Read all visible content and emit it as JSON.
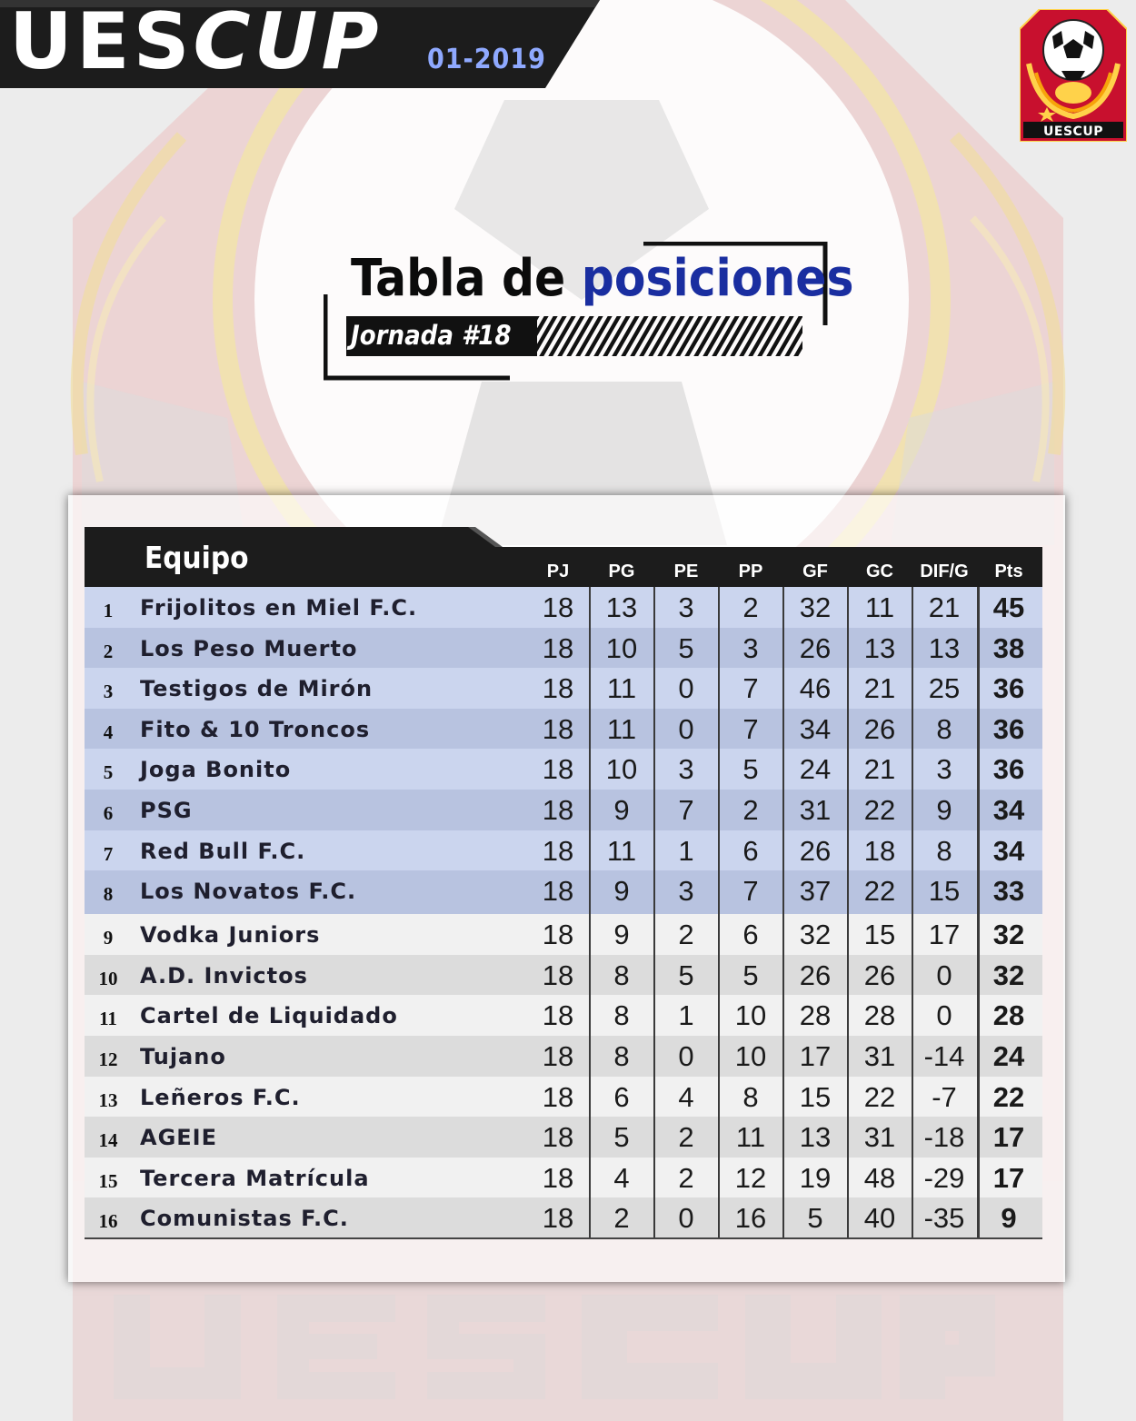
{
  "brand": {
    "title_a": "UES",
    "title_b": "CUP",
    "season": "01-2019",
    "logo_text": "UESCUP"
  },
  "heading": {
    "title_a": "Tabla de",
    "title_b": "posiciones",
    "subtitle": "Jornada #18"
  },
  "colors": {
    "brand_dark": "#1a1a1a",
    "accent_blue": "#1a2ea0",
    "season_blue": "#8fa9ff",
    "top8_row": "#cbd5ee",
    "logo_red": "#c8102e"
  },
  "table": {
    "team_header": "Equipo",
    "columns": [
      "PJ",
      "PG",
      "PE",
      "PP",
      "GF",
      "GC",
      "DIF/G",
      "Pts"
    ],
    "rows": [
      {
        "rank": "1",
        "team": "Frijolitos en Miel F.C.",
        "PJ": "18",
        "PG": "13",
        "PE": "3",
        "PP": "2",
        "GF": "32",
        "GC": "11",
        "DIF": "21",
        "Pts": "45"
      },
      {
        "rank": "2",
        "team": "Los Peso Muerto",
        "PJ": "18",
        "PG": "10",
        "PE": "5",
        "PP": "3",
        "GF": "26",
        "GC": "13",
        "DIF": "13",
        "Pts": "38"
      },
      {
        "rank": "3",
        "team": "Testigos de Mirón",
        "PJ": "18",
        "PG": "11",
        "PE": "0",
        "PP": "7",
        "GF": "46",
        "GC": "21",
        "DIF": "25",
        "Pts": "36"
      },
      {
        "rank": "4",
        "team": "Fito & 10 Troncos",
        "PJ": "18",
        "PG": "11",
        "PE": "0",
        "PP": "7",
        "GF": "34",
        "GC": "26",
        "DIF": "8",
        "Pts": "36"
      },
      {
        "rank": "5",
        "team": "Joga Bonito",
        "PJ": "18",
        "PG": "10",
        "PE": "3",
        "PP": "5",
        "GF": "24",
        "GC": "21",
        "DIF": "3",
        "Pts": "36"
      },
      {
        "rank": "6",
        "team": "PSG",
        "PJ": "18",
        "PG": "9",
        "PE": "7",
        "PP": "2",
        "GF": "31",
        "GC": "22",
        "DIF": "9",
        "Pts": "34"
      },
      {
        "rank": "7",
        "team": "Red Bull F.C.",
        "PJ": "18",
        "PG": "11",
        "PE": "1",
        "PP": "6",
        "GF": "26",
        "GC": "18",
        "DIF": "8",
        "Pts": "34"
      },
      {
        "rank": "8",
        "team": "Los Novatos F.C.",
        "PJ": "18",
        "PG": "9",
        "PE": "3",
        "PP": "7",
        "GF": "37",
        "GC": "22",
        "DIF": "15",
        "Pts": "33"
      },
      {
        "rank": "9",
        "team": "Vodka Juniors",
        "PJ": "18",
        "PG": "9",
        "PE": "2",
        "PP": "6",
        "GF": "32",
        "GC": "15",
        "DIF": "17",
        "Pts": "32"
      },
      {
        "rank": "10",
        "team": "A.D. Invictos",
        "PJ": "18",
        "PG": "8",
        "PE": "5",
        "PP": "5",
        "GF": "26",
        "GC": "26",
        "DIF": "0",
        "Pts": "32"
      },
      {
        "rank": "11",
        "team": "Cartel de Liquidado",
        "PJ": "18",
        "PG": "8",
        "PE": "1",
        "PP": "10",
        "GF": "28",
        "GC": "28",
        "DIF": "0",
        "Pts": "28"
      },
      {
        "rank": "12",
        "team": "Tujano",
        "PJ": "18",
        "PG": "8",
        "PE": "0",
        "PP": "10",
        "GF": "17",
        "GC": "31",
        "DIF": "-14",
        "Pts": "24"
      },
      {
        "rank": "13",
        "team": "Leñeros F.C.",
        "PJ": "18",
        "PG": "6",
        "PE": "4",
        "PP": "8",
        "GF": "15",
        "GC": "22",
        "DIF": "-7",
        "Pts": "22"
      },
      {
        "rank": "14",
        "team": "AGEIE",
        "PJ": "18",
        "PG": "5",
        "PE": "2",
        "PP": "11",
        "GF": "13",
        "GC": "31",
        "DIF": "-18",
        "Pts": "17"
      },
      {
        "rank": "15",
        "team": "Tercera Matrícula",
        "PJ": "18",
        "PG": "4",
        "PE": "2",
        "PP": "12",
        "GF": "19",
        "GC": "48",
        "DIF": "-29",
        "Pts": "17"
      },
      {
        "rank": "16",
        "team": "Comunistas F.C.",
        "PJ": "18",
        "PG": "2",
        "PE": "0",
        "PP": "16",
        "GF": "5",
        "GC": "40",
        "DIF": "-35",
        "Pts": "9"
      }
    ]
  }
}
